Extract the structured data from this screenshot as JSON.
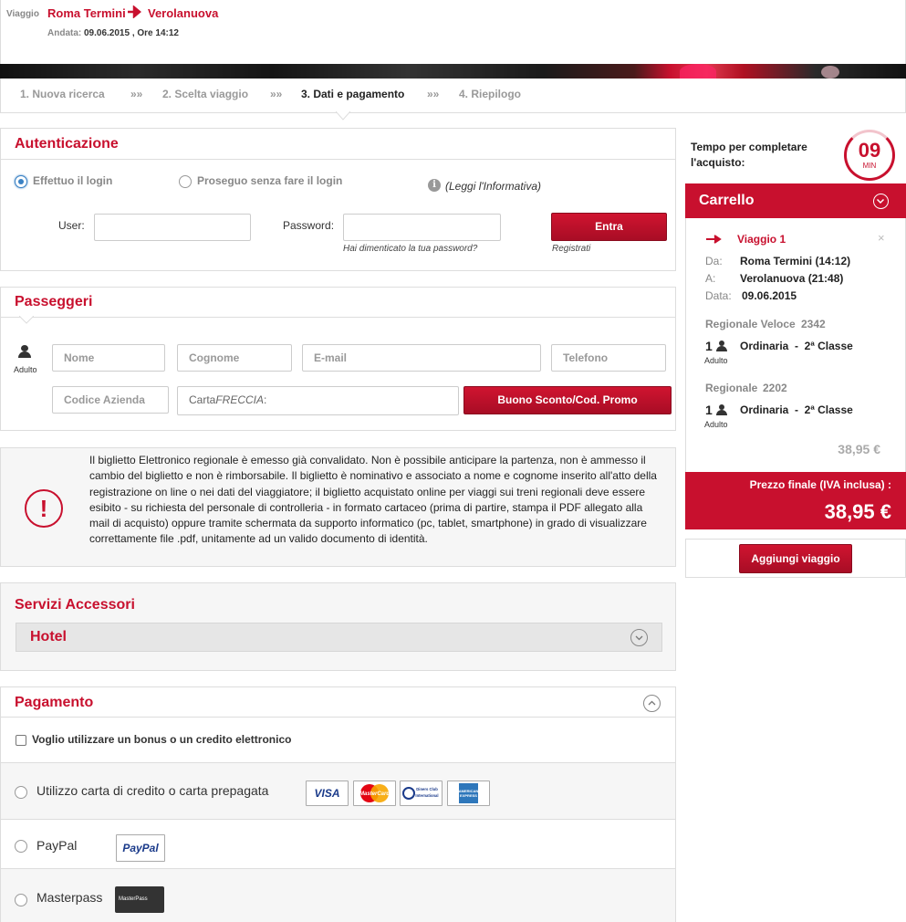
{
  "header": {
    "viaggio_label": "Viaggio",
    "from": "Roma Termini",
    "to": "Verolanuova",
    "andata_label": "Andata:",
    "andata_value": "09.06.2015 , Ore 14:12"
  },
  "steps": [
    {
      "label": "1. Nuova ricerca"
    },
    {
      "label": "2. Scelta viaggio"
    },
    {
      "label": "3. Dati e pagamento"
    },
    {
      "label": "4. Riepilogo"
    }
  ],
  "step_separator": "»»",
  "auth": {
    "title": "Autenticazione",
    "option_login": "Effettuo il login",
    "option_guest": "Proseguo senza fare il login",
    "info_link": "(Leggi l'Informativa)",
    "user_label": "User:",
    "password_label": "Password:",
    "forgot": "Hai dimenticato la tua password?",
    "enter_button": "Entra",
    "register": "Registrati"
  },
  "passengers": {
    "title": "Passeggeri",
    "type_label": "Adulto",
    "nome_placeholder": "Nome",
    "cognome_placeholder": "Cognome",
    "email_placeholder": "E-mail",
    "telefono_placeholder": "Telefono",
    "codice_placeholder": "Codice Azienda",
    "carta_prefix": "Carta",
    "carta_italic": "FRECCIA",
    "carta_suffix": ":",
    "promo_button": "Buono Sconto/Cod. Promo"
  },
  "notice": {
    "icon": "exclamation-icon",
    "text": "Il biglietto Elettronico regionale è emesso già convalidato. Non è possibile anticipare la partenza, non è ammesso il cambio del biglietto e non è rimborsabile. Il biglietto è nominativo e associato a nome e cognome inserito all'atto della registrazione on line o nei dati del viaggiatore; il biglietto acquistato online per viaggi sui treni regionali deve essere esibito - su richiesta del personale di controlleria - in formato cartaceo (prima di partire, stampa il PDF allegato alla mail di acquisto) oppure tramite schermata da supporto informatico (pc, tablet, smartphone) in grado di visualizzare correttamente file .pdf, unitamente ad un valido documento di identità."
  },
  "services": {
    "title": "Servizi Accessori",
    "hotel": "Hotel"
  },
  "payment": {
    "title": "Pagamento",
    "bonus_label": "Voglio utilizzare un bonus o un credito elettronico",
    "card_label": "Utilizzo carta di credito o carta prepagata",
    "paypal_label": "PayPal",
    "masterpass_label": "Masterpass",
    "cards": [
      "VISA",
      "MasterCard",
      "Diners Club International",
      "AMERICAN EXPRESS"
    ],
    "paypal_logo": "PayPal",
    "masterpass_logo": "MasterPass"
  },
  "timer": {
    "label_line1": "Tempo per completare",
    "label_line2": "l'acquisto:",
    "minutes": "09",
    "unit": "MIN"
  },
  "cart": {
    "title": "Carrello",
    "trip_title": "Viaggio 1",
    "da_label": "Da:",
    "da_value": "Roma Termini (14:12)",
    "a_label": "A:",
    "a_value": "Verolanuova (21:48)",
    "data_label": "Data:",
    "data_value": "09.06.2015",
    "segments": [
      {
        "train": "Regionale Veloce",
        "number": "2342",
        "count": "1",
        "type": "Adulto",
        "fare": "Ordinaria  -  2ª Classe"
      },
      {
        "train": "Regionale",
        "number": "2202",
        "count": "1",
        "type": "Adulto",
        "fare": "Ordinaria  -  2ª Classe"
      }
    ],
    "subtotal": "38,95 €",
    "final_label": "Prezzo finale (IVA inclusa) :",
    "final_value": "38,95 €",
    "add_trip_button": "Aggiungi viaggio"
  },
  "colors": {
    "brand_red": "#c8102e"
  }
}
